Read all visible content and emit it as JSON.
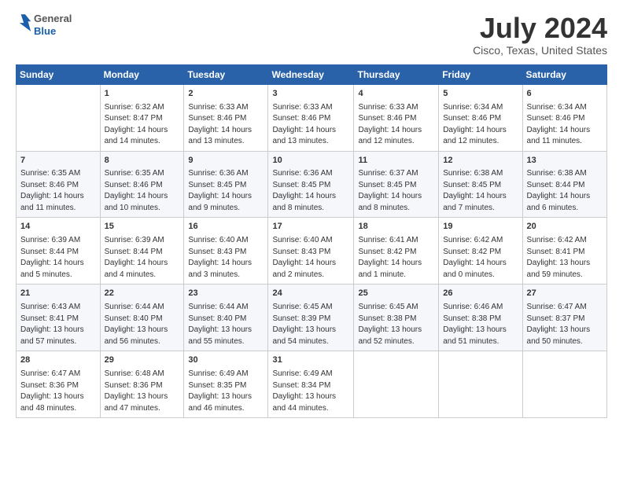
{
  "logo": {
    "general": "General",
    "blue": "Blue"
  },
  "title": {
    "month": "July 2024",
    "location": "Cisco, Texas, United States"
  },
  "headers": [
    "Sunday",
    "Monday",
    "Tuesday",
    "Wednesday",
    "Thursday",
    "Friday",
    "Saturday"
  ],
  "weeks": [
    [
      {
        "day": "",
        "info": ""
      },
      {
        "day": "1",
        "info": "Sunrise: 6:32 AM\nSunset: 8:47 PM\nDaylight: 14 hours\nand 14 minutes."
      },
      {
        "day": "2",
        "info": "Sunrise: 6:33 AM\nSunset: 8:46 PM\nDaylight: 14 hours\nand 13 minutes."
      },
      {
        "day": "3",
        "info": "Sunrise: 6:33 AM\nSunset: 8:46 PM\nDaylight: 14 hours\nand 13 minutes."
      },
      {
        "day": "4",
        "info": "Sunrise: 6:33 AM\nSunset: 8:46 PM\nDaylight: 14 hours\nand 12 minutes."
      },
      {
        "day": "5",
        "info": "Sunrise: 6:34 AM\nSunset: 8:46 PM\nDaylight: 14 hours\nand 12 minutes."
      },
      {
        "day": "6",
        "info": "Sunrise: 6:34 AM\nSunset: 8:46 PM\nDaylight: 14 hours\nand 11 minutes."
      }
    ],
    [
      {
        "day": "7",
        "info": "Sunrise: 6:35 AM\nSunset: 8:46 PM\nDaylight: 14 hours\nand 11 minutes."
      },
      {
        "day": "8",
        "info": "Sunrise: 6:35 AM\nSunset: 8:46 PM\nDaylight: 14 hours\nand 10 minutes."
      },
      {
        "day": "9",
        "info": "Sunrise: 6:36 AM\nSunset: 8:45 PM\nDaylight: 14 hours\nand 9 minutes."
      },
      {
        "day": "10",
        "info": "Sunrise: 6:36 AM\nSunset: 8:45 PM\nDaylight: 14 hours\nand 8 minutes."
      },
      {
        "day": "11",
        "info": "Sunrise: 6:37 AM\nSunset: 8:45 PM\nDaylight: 14 hours\nand 8 minutes."
      },
      {
        "day": "12",
        "info": "Sunrise: 6:38 AM\nSunset: 8:45 PM\nDaylight: 14 hours\nand 7 minutes."
      },
      {
        "day": "13",
        "info": "Sunrise: 6:38 AM\nSunset: 8:44 PM\nDaylight: 14 hours\nand 6 minutes."
      }
    ],
    [
      {
        "day": "14",
        "info": "Sunrise: 6:39 AM\nSunset: 8:44 PM\nDaylight: 14 hours\nand 5 minutes."
      },
      {
        "day": "15",
        "info": "Sunrise: 6:39 AM\nSunset: 8:44 PM\nDaylight: 14 hours\nand 4 minutes."
      },
      {
        "day": "16",
        "info": "Sunrise: 6:40 AM\nSunset: 8:43 PM\nDaylight: 14 hours\nand 3 minutes."
      },
      {
        "day": "17",
        "info": "Sunrise: 6:40 AM\nSunset: 8:43 PM\nDaylight: 14 hours\nand 2 minutes."
      },
      {
        "day": "18",
        "info": "Sunrise: 6:41 AM\nSunset: 8:42 PM\nDaylight: 14 hours\nand 1 minute."
      },
      {
        "day": "19",
        "info": "Sunrise: 6:42 AM\nSunset: 8:42 PM\nDaylight: 14 hours\nand 0 minutes."
      },
      {
        "day": "20",
        "info": "Sunrise: 6:42 AM\nSunset: 8:41 PM\nDaylight: 13 hours\nand 59 minutes."
      }
    ],
    [
      {
        "day": "21",
        "info": "Sunrise: 6:43 AM\nSunset: 8:41 PM\nDaylight: 13 hours\nand 57 minutes."
      },
      {
        "day": "22",
        "info": "Sunrise: 6:44 AM\nSunset: 8:40 PM\nDaylight: 13 hours\nand 56 minutes."
      },
      {
        "day": "23",
        "info": "Sunrise: 6:44 AM\nSunset: 8:40 PM\nDaylight: 13 hours\nand 55 minutes."
      },
      {
        "day": "24",
        "info": "Sunrise: 6:45 AM\nSunset: 8:39 PM\nDaylight: 13 hours\nand 54 minutes."
      },
      {
        "day": "25",
        "info": "Sunrise: 6:45 AM\nSunset: 8:38 PM\nDaylight: 13 hours\nand 52 minutes."
      },
      {
        "day": "26",
        "info": "Sunrise: 6:46 AM\nSunset: 8:38 PM\nDaylight: 13 hours\nand 51 minutes."
      },
      {
        "day": "27",
        "info": "Sunrise: 6:47 AM\nSunset: 8:37 PM\nDaylight: 13 hours\nand 50 minutes."
      }
    ],
    [
      {
        "day": "28",
        "info": "Sunrise: 6:47 AM\nSunset: 8:36 PM\nDaylight: 13 hours\nand 48 minutes."
      },
      {
        "day": "29",
        "info": "Sunrise: 6:48 AM\nSunset: 8:36 PM\nDaylight: 13 hours\nand 47 minutes."
      },
      {
        "day": "30",
        "info": "Sunrise: 6:49 AM\nSunset: 8:35 PM\nDaylight: 13 hours\nand 46 minutes."
      },
      {
        "day": "31",
        "info": "Sunrise: 6:49 AM\nSunset: 8:34 PM\nDaylight: 13 hours\nand 44 minutes."
      },
      {
        "day": "",
        "info": ""
      },
      {
        "day": "",
        "info": ""
      },
      {
        "day": "",
        "info": ""
      }
    ]
  ]
}
